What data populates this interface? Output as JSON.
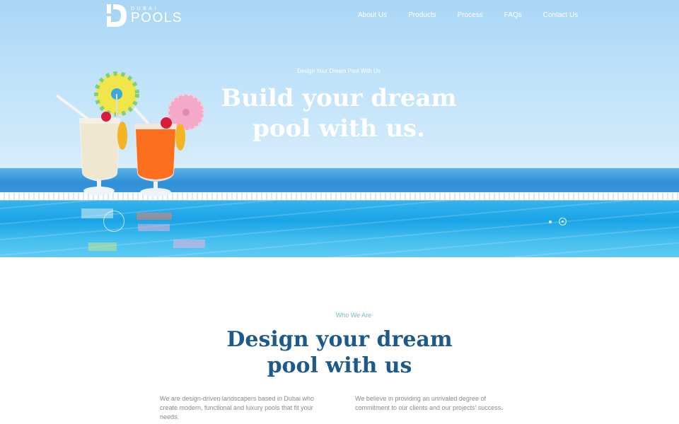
{
  "logo": {
    "small": "DUBAI",
    "big": "POOLS"
  },
  "nav": {
    "items": [
      {
        "label": "About Us"
      },
      {
        "label": "Products"
      },
      {
        "label": "Process"
      },
      {
        "label": "FAQs"
      },
      {
        "label": "Contact Us"
      }
    ]
  },
  "hero": {
    "kicker": "Design Your Dream Pool With Us",
    "title": "Build your dream pool with us.",
    "slider": {
      "slide_count": 2,
      "active_slide": 2
    }
  },
  "about": {
    "kicker": "Who We Are",
    "title": "Design your dream pool with us",
    "columns": [
      {
        "text": "We are design-driven landscapers based in Dubai who create modern, functional and luxury pools that fit your needs."
      },
      {
        "text": "We believe in providing an unrivaled degree of commitment to our clients and our projects' success."
      }
    ]
  },
  "colors": {
    "heading": "#1d5a8a",
    "kicker": "#77b6c6",
    "body_text": "#8a8a8a",
    "sky": "#cfe9fb",
    "pool": "#19a4e6"
  }
}
